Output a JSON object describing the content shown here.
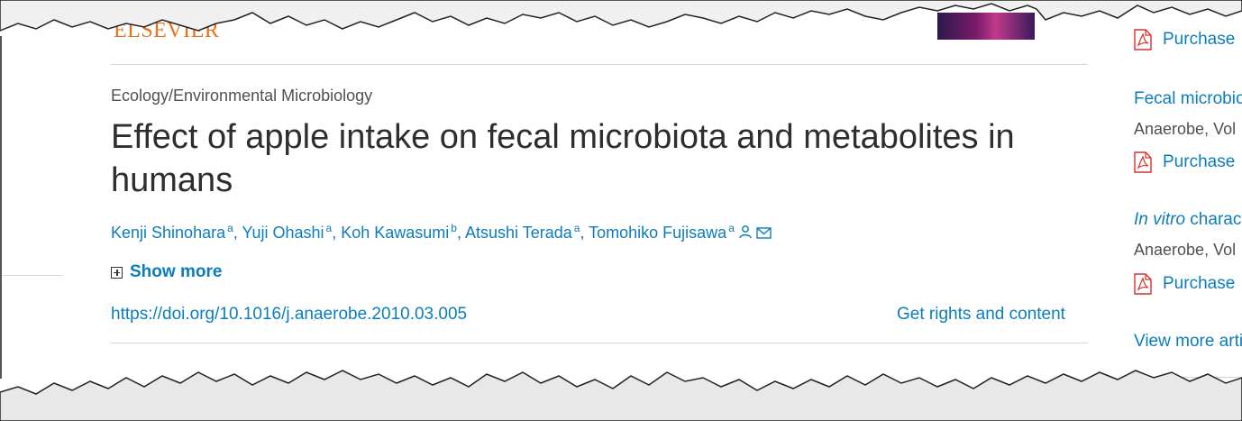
{
  "publisher": {
    "logo_text": "ELSEVIER"
  },
  "article": {
    "subject": "Ecology/Environmental Microbiology",
    "title": "Effect of apple intake on fecal microbiota and metabolites in humans",
    "authors": [
      {
        "name": "Kenji Shinohara",
        "affil": "a"
      },
      {
        "name": "Yuji Ohashi",
        "affil": "a"
      },
      {
        "name": "Koh Kawasumi",
        "affil": "b"
      },
      {
        "name": "Atsushi Terada",
        "affil": "a"
      },
      {
        "name": "Tomohiko Fujisawa",
        "affil": "a"
      }
    ],
    "show_more": "Show more",
    "doi": "https://doi.org/10.1016/j.anaerobe.2010.03.005",
    "rights": "Get rights and content"
  },
  "sidebar": {
    "purchase_label": "Purchase",
    "items": [
      {
        "title": "Fecal microbiota",
        "journal": "Anaerobe, Vol"
      },
      {
        "title_italic": "In vitro",
        "title_rest": " characterization",
        "journal": "Anaerobe, Vol"
      }
    ],
    "view_more": "View more articles"
  },
  "colors": {
    "link": "#0c7dbb",
    "text": "#2e2e2e",
    "publisher": "#e9711c",
    "pdf_icon": "#d9302c"
  }
}
